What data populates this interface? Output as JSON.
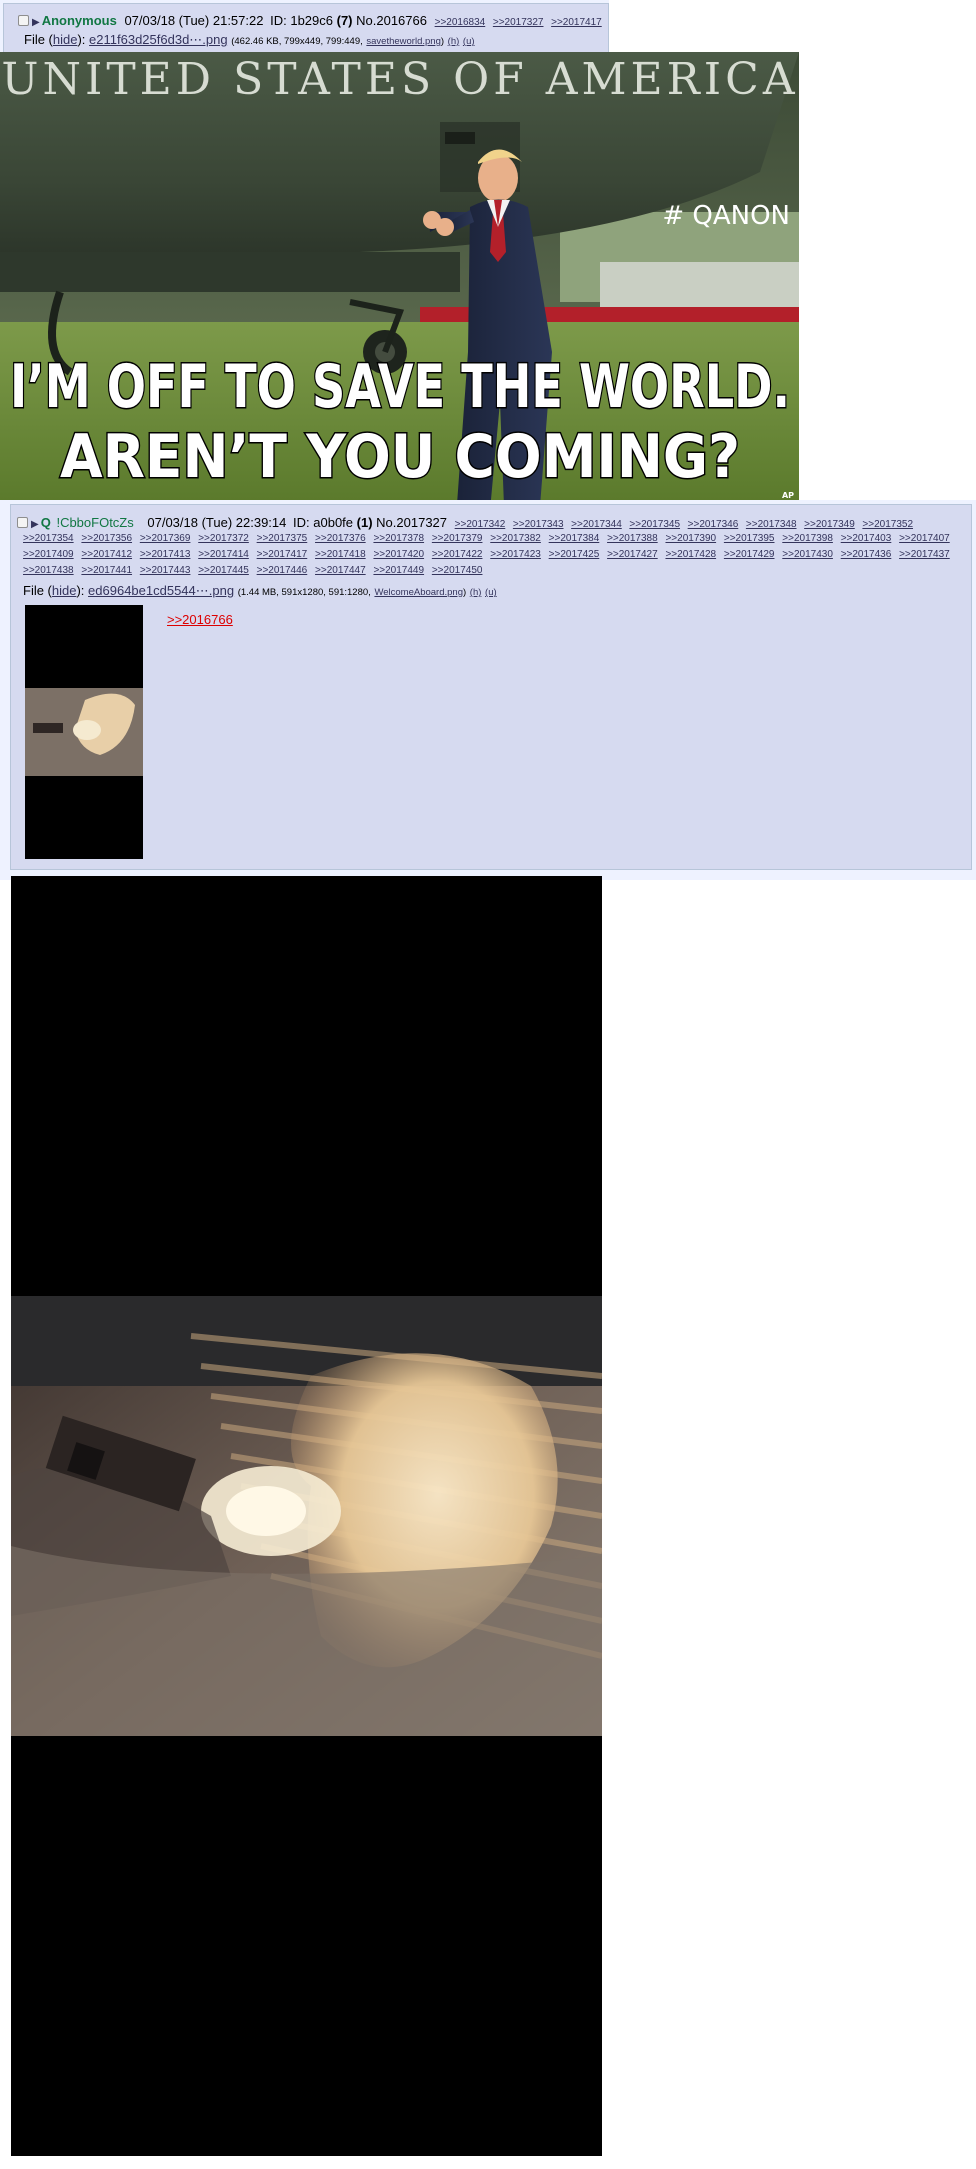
{
  "post1": {
    "name": "Anonymous",
    "date": "07/03/18 (Tue) 21:57:22",
    "id_label": "ID:",
    "id": "1b29c6",
    "id_count": "(7)",
    "postno": "No.2016766",
    "backlinks": [
      ">>2016834",
      ">>2017327",
      ">>2017417"
    ],
    "file": {
      "prefix": "File (",
      "hide": "hide",
      "sep": "):",
      "filename": "e211f63d25f6d3d⋯.png",
      "meta": "(462.46 KB, 799x449, 799:449,",
      "original_name": "savetheworld.png",
      "close": ")",
      "h": "(h)",
      "u": "(u)"
    },
    "image": {
      "banner_text": "UNITED STATES OF AMERICA",
      "hashtag": "# QANON",
      "line1": "I’M OFF TO SAVE THE WORLD.",
      "line2": "AREN’T YOU COMING?",
      "credit": "AP"
    }
  },
  "post2": {
    "name": "Q",
    "tripcode": "!CbboFOtcZs",
    "date": "07/03/18 (Tue) 22:39:14",
    "id_label": "ID:",
    "id": "a0b0fe",
    "id_count": "(1)",
    "postno": "No.2017327",
    "backlinks_row0": [
      ">>2017342",
      ">>2017343",
      ">>2017344",
      ">>2017345",
      ">>2017346",
      ">>2017348",
      ">>2017349",
      ">>2017352"
    ],
    "backlinks_row1": [
      ">>2017354",
      ">>2017356",
      ">>2017369",
      ">>2017372",
      ">>2017375",
      ">>2017376",
      ">>2017378",
      ">>2017379",
      ">>2017382",
      ">>2017384",
      ">>2017388",
      ">>2017390",
      ">>2017395",
      ">>2017398",
      ">>2017403",
      ">>2017407"
    ],
    "backlinks_row2": [
      ">>2017409",
      ">>2017412",
      ">>2017413",
      ">>2017414",
      ">>2017417",
      ">>2017418",
      ">>2017420",
      ">>2017422",
      ">>2017423",
      ">>2017425",
      ">>2017427",
      ">>2017428",
      ">>2017429",
      ">>2017430",
      ">>2017436",
      ">>2017437"
    ],
    "backlinks_row3": [
      ">>2017438",
      ">>2017441",
      ">>2017443",
      ">>2017445",
      ">>2017446",
      ">>2017447",
      ">>2017449",
      ">>2017450"
    ],
    "file": {
      "prefix": "File (",
      "hide": "hide",
      "sep": "):",
      "filename": "ed6964be1cd5544⋯.png",
      "meta": "(1.44 MB, 591x1280, 591:1280,",
      "original_name": "WelcomeAboard.png",
      "close": ")",
      "h": "(h)",
      "u": "(u)"
    },
    "quote": ">>2016766"
  },
  "colors": {
    "post_bg": "#d6daf0",
    "page_bg": "#eef2ff",
    "name": "#117743",
    "link": "#34345c",
    "quote": "#dd0000"
  }
}
